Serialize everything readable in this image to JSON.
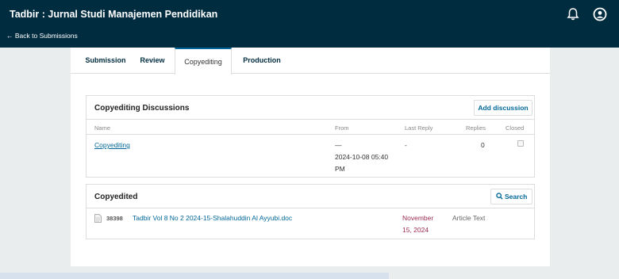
{
  "header": {
    "app_title": "Tadbir : Jurnal Studi Manajemen Pendidikan",
    "back_link": "← Back to Submissions",
    "icons": [
      "bell-icon",
      "user-circle-icon"
    ]
  },
  "tabs": [
    {
      "label": "Submission",
      "active": false
    },
    {
      "label": "Review",
      "active": false
    },
    {
      "label": "Copyediting",
      "active": true
    },
    {
      "label": "Production",
      "active": false
    }
  ],
  "discussions": {
    "title": "Copyediting Discussions",
    "add_button": "Add discussion",
    "columns": {
      "name": "Name",
      "from": "From",
      "last_reply": "Last Reply",
      "replies": "Replies",
      "closed": "Closed"
    },
    "rows": [
      {
        "name": "Copyediting",
        "from_line1": "—",
        "from_line2": "2024-10-08 05:40",
        "from_line3": "PM",
        "last_reply": "-",
        "replies": "0",
        "closed": false
      }
    ]
  },
  "copyedited": {
    "title": "Copyedited",
    "search_button": "Search",
    "files": [
      {
        "id": "38398",
        "name": "Tadbir Vol 8 No 2 2024-15-Shalahuddin Al Ayyubi.doc",
        "date_line1": "November",
        "date_line2": "15, 2024",
        "type": "Article Text"
      }
    ]
  },
  "colors": {
    "header_bg": "#002c40",
    "link": "#006798",
    "date": "#9a2a4f",
    "page_bg": "#eaedee"
  }
}
